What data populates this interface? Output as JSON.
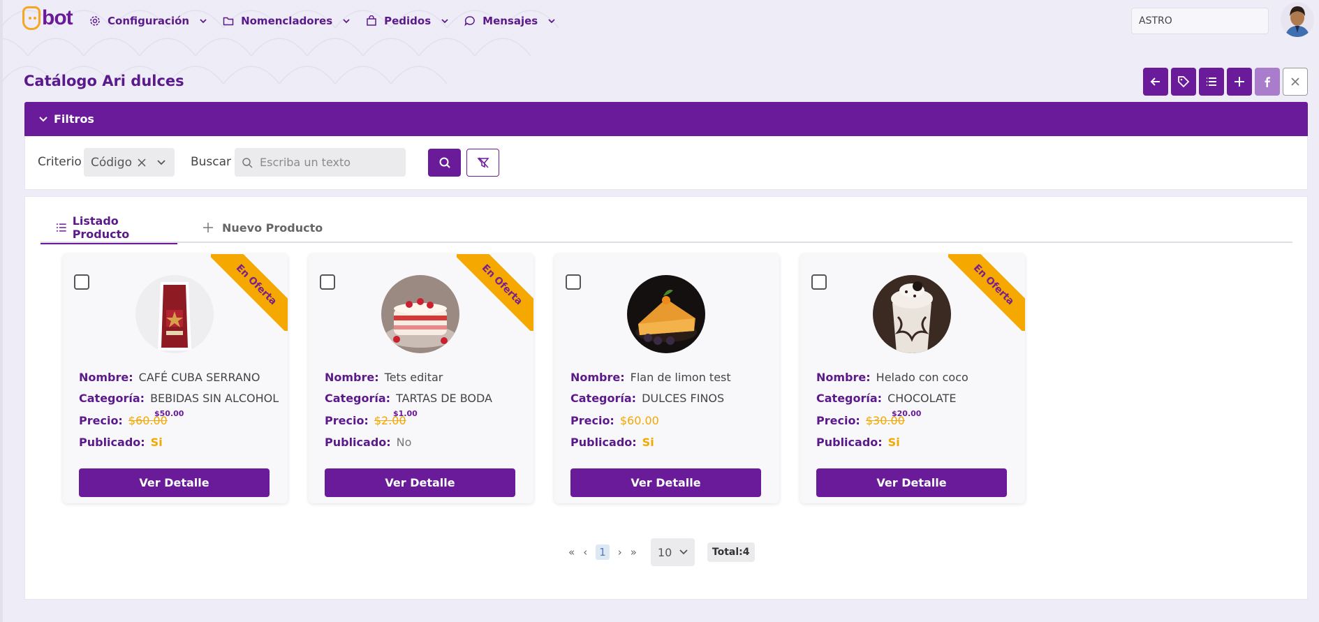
{
  "brand": {
    "logo_text": "bot"
  },
  "nav": {
    "items": [
      {
        "label": "Configuración",
        "icon": "gear-icon"
      },
      {
        "label": "Nomencladores",
        "icon": "folder-icon"
      },
      {
        "label": "Pedidos",
        "icon": "bag-icon"
      },
      {
        "label": "Mensajes",
        "icon": "chat-icon"
      }
    ],
    "user_field": "ASTRO"
  },
  "page": {
    "title": "Catálogo Ari dulces"
  },
  "filters": {
    "header": "Filtros",
    "criterio_label": "Criterio",
    "criterio_value": "Código",
    "buscar_label": "Buscar",
    "search_placeholder": "Escriba un texto"
  },
  "tabs": [
    {
      "label": "Listado Producto",
      "active": true
    },
    {
      "label": "Nuevo Producto",
      "active": false
    }
  ],
  "labels": {
    "nombre": "Nombre:",
    "categoria": "Categoría:",
    "precio": "Precio:",
    "publicado": "Publicado:",
    "detail_button": "Ver Detalle",
    "ribbon": "En Oferta"
  },
  "products": [
    {
      "name": "CAFÉ CUBA SERRANO",
      "category": "BEBIDAS SIN ALCOHOL",
      "price": "$60.00",
      "offer_price": "$50.00",
      "published": "Si",
      "on_offer": true
    },
    {
      "name": "Tets editar",
      "category": "TARTAS DE BODA",
      "price": "$2.00",
      "offer_price": "$1.00",
      "published": "No",
      "on_offer": true
    },
    {
      "name": "Flan de limon test",
      "category": "DULCES FINOS",
      "price": "$60.00",
      "offer_price": "",
      "published": "Si",
      "on_offer": false
    },
    {
      "name": "Helado con coco",
      "category": "CHOCOLATE",
      "price": "$30.00",
      "offer_price": "$20.00",
      "published": "Si",
      "on_offer": true
    }
  ],
  "pagination": {
    "first": "«",
    "prev": "‹",
    "current_page": "1",
    "next": "›",
    "last": "»",
    "rows_per_page": "10",
    "total": "Total:4"
  },
  "colors": {
    "primary": "#6a1b9a",
    "accent": "#f5a800"
  }
}
